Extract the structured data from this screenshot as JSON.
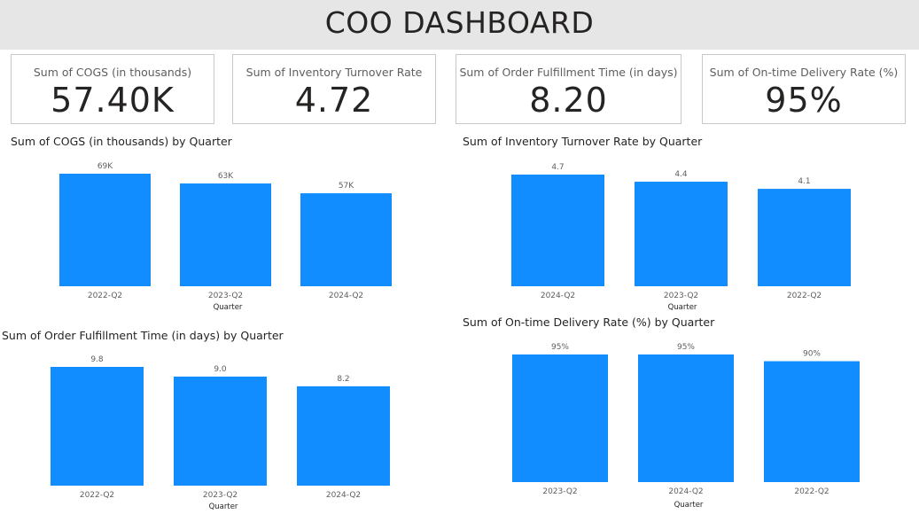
{
  "header": {
    "title": "COO DASHBOARD"
  },
  "kpis": [
    {
      "label": "Sum of COGS (in thousands)",
      "value": "57.40K"
    },
    {
      "label": "Sum of Inventory Turnover Rate",
      "value": "4.72"
    },
    {
      "label": "Sum of Order Fulfillment Time (in days)",
      "value": "8.20"
    },
    {
      "label": "Sum of On-time Delivery Rate (%)",
      "value": "95%"
    }
  ],
  "colors": {
    "bar": "#118dff",
    "header_bg": "#e6e6e6"
  },
  "chart_data": [
    {
      "type": "bar",
      "title": "Sum of COGS (in thousands) by Quarter",
      "xlabel": "Quarter",
      "ylabel": "",
      "categories": [
        "2022-Q2",
        "2023-Q2",
        "2024-Q2"
      ],
      "values": [
        69,
        63,
        57
      ],
      "data_labels": [
        "69K",
        "63K",
        "57K"
      ],
      "ylim": [
        0,
        69
      ]
    },
    {
      "type": "bar",
      "title": "Sum of Inventory Turnover Rate by Quarter",
      "xlabel": "Quarter",
      "ylabel": "",
      "categories": [
        "2024-Q2",
        "2023-Q2",
        "2022-Q2"
      ],
      "values": [
        4.7,
        4.4,
        4.1
      ],
      "data_labels": [
        "4.7",
        "4.4",
        "4.1"
      ],
      "ylim": [
        0,
        4.7
      ]
    },
    {
      "type": "bar",
      "title": "Sum of Order Fulfillment Time (in days) by Quarter",
      "xlabel": "Quarter",
      "ylabel": "",
      "categories": [
        "2022-Q2",
        "2023-Q2",
        "2024-Q2"
      ],
      "values": [
        9.8,
        9.0,
        8.2
      ],
      "data_labels": [
        "9.8",
        "9.0",
        "8.2"
      ],
      "ylim": [
        0,
        9.8
      ]
    },
    {
      "type": "bar",
      "title": "Sum of On-time Delivery Rate (%) by Quarter",
      "xlabel": "Quarter",
      "ylabel": "",
      "categories": [
        "2023-Q2",
        "2024-Q2",
        "2022-Q2"
      ],
      "values": [
        95,
        95,
        90
      ],
      "data_labels": [
        "95%",
        "95%",
        "90%"
      ],
      "ylim": [
        0,
        95
      ]
    }
  ]
}
